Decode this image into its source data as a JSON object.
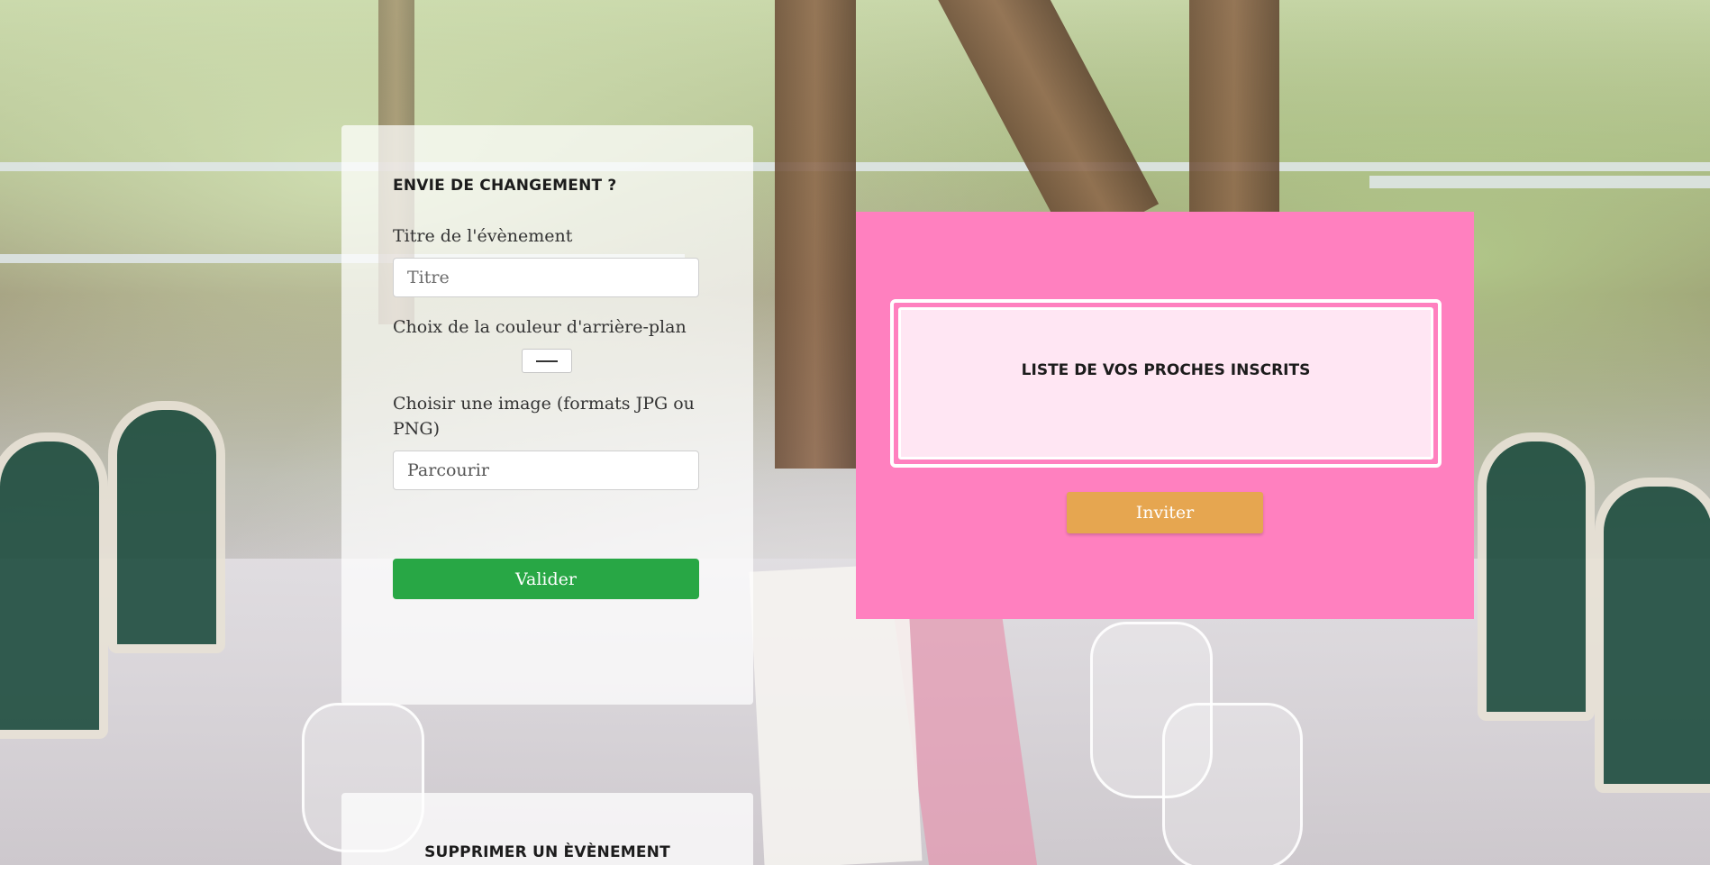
{
  "change_panel": {
    "title": "ENVIE DE CHANGEMENT ?",
    "event_title_label": "Titre de l'évènement",
    "event_title_placeholder": "Titre",
    "bg_color_label": "Choix de la couleur d'arrière-plan",
    "image_label": "Choisir une image (formats JPG ou PNG)",
    "file_button_label": "Parcourir",
    "validate_label": "Valider"
  },
  "delete_panel": {
    "title": "SUPPRIMER UN ÈVÈNEMENT"
  },
  "guests_panel": {
    "title": "LISTE DE VOS PROCHES INSCRITS",
    "invite_label": "Inviter"
  },
  "colors": {
    "pink_panel": "#ff80bf",
    "guest_box": "#ffe6f3",
    "validate_button": "#28a745",
    "invite_button": "#e6a650"
  }
}
